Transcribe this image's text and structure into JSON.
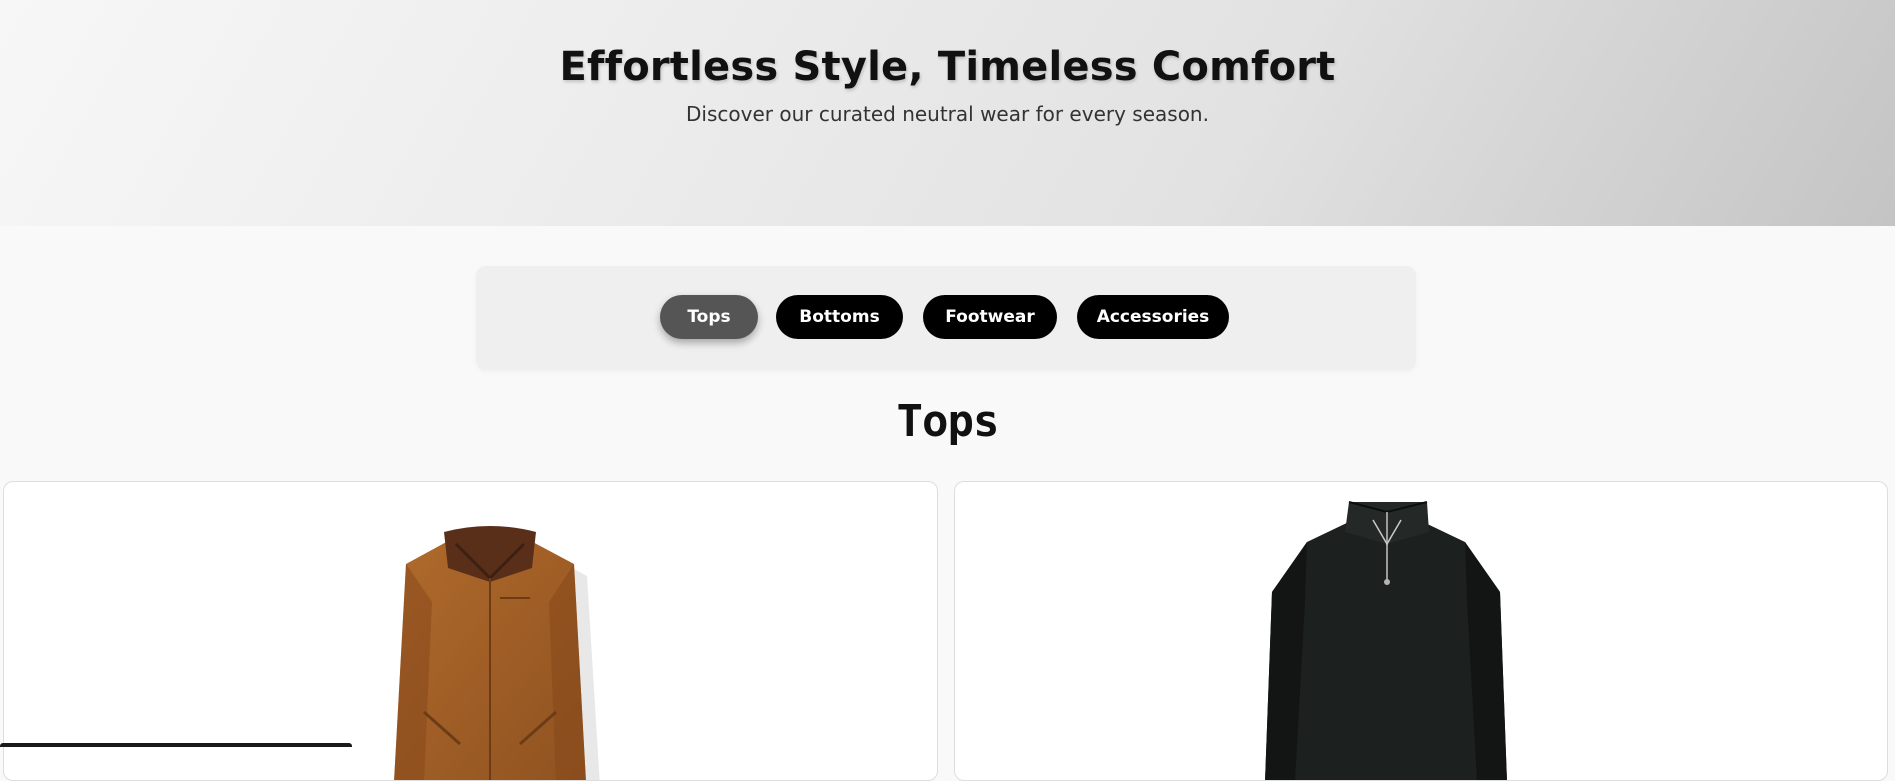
{
  "hero": {
    "title": "Effortless Style, Timeless Comfort",
    "subtitle": "Discover our curated neutral wear for every season."
  },
  "filters": {
    "items": [
      {
        "label": "Tops",
        "active": true
      },
      {
        "label": "Bottoms",
        "active": false
      },
      {
        "label": "Footwear",
        "active": false
      },
      {
        "label": "Accessories",
        "active": false
      }
    ]
  },
  "section": {
    "title": "Tops"
  },
  "products": [
    {
      "image": "brown-jacket",
      "color": "#a4622a"
    },
    {
      "image": "black-quarter-zip-sweatshirt",
      "color": "#1c201f"
    }
  ],
  "colors": {
    "button_bg": "#000000",
    "button_active_bg": "#555555",
    "page_bg": "#f9f9f9"
  }
}
